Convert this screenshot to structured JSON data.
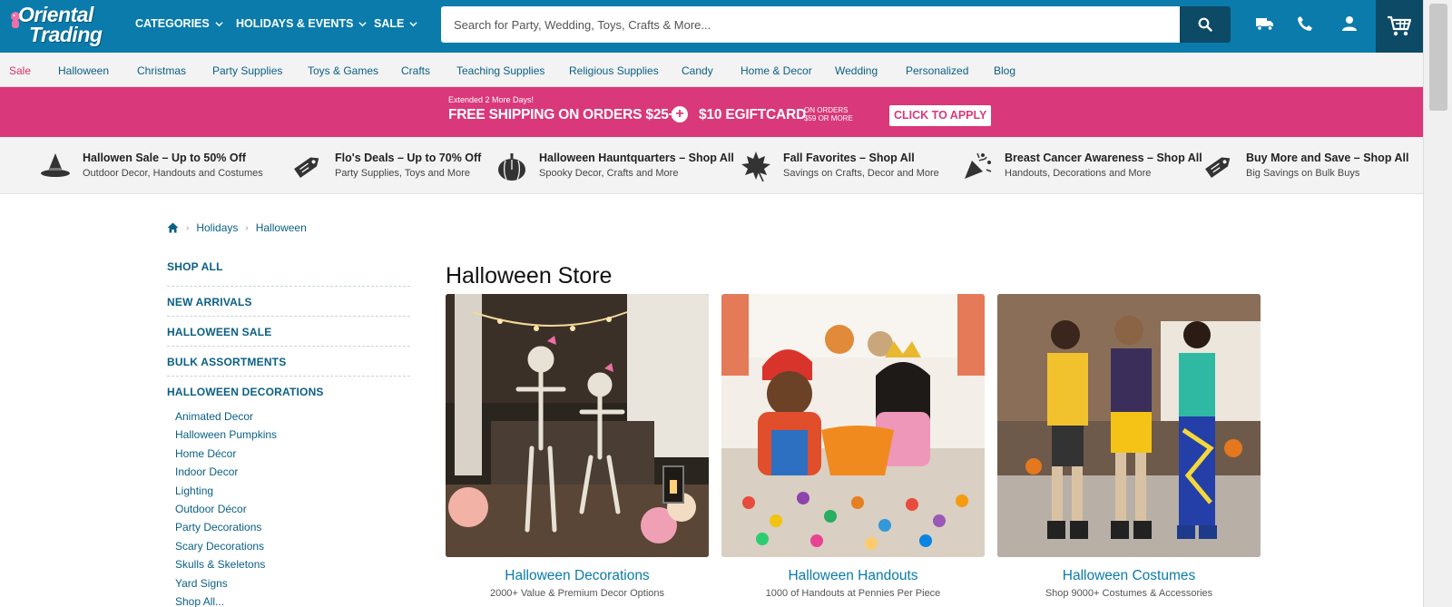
{
  "brand": {
    "line1": "Oriental",
    "line2": "Trading"
  },
  "header": {
    "nav": [
      {
        "label": "CATEGORIES"
      },
      {
        "label": "HOLIDAYS & EVENTS"
      },
      {
        "label": "SALE"
      }
    ],
    "search_placeholder": "Search for Party, Wedding, Toys, Crafts & More...",
    "icons": [
      "truck-icon",
      "phone-icon",
      "user-icon",
      "cart-icon"
    ]
  },
  "categories": [
    "Sale",
    "Halloween",
    "Christmas",
    "Party Supplies",
    "Toys & Games",
    "Crafts",
    "Teaching Supplies",
    "Religious Supplies",
    "Candy",
    "Home & Decor",
    "Wedding",
    "Personalized",
    "Blog"
  ],
  "promo": {
    "small": "Extended 2 More Days!",
    "offer1": "FREE SHIPPING ON ORDERS $25+",
    "offer2": "$10 EGIFTCARD",
    "on_orders_1": "ON ORDERS",
    "on_orders_2": "$59 OR MORE",
    "cta": "CLICK TO APPLY"
  },
  "deals": [
    {
      "title": "Hallowen Sale – Up to 50% Off",
      "sub": "Outdoor Decor, Handouts and Costumes",
      "icon": "witch-hat-icon"
    },
    {
      "title": "Flo's Deals – Up to 70% Off",
      "sub": "Party Supplies, Toys and More",
      "icon": "price-tag-icon"
    },
    {
      "title": "Halloween Hauntquarters – Shop All",
      "sub": "Spooky Decor, Crafts and More",
      "icon": "pumpkin-icon"
    },
    {
      "title": "Fall Favorites – Shop All",
      "sub": "Savings on Crafts, Decor and More",
      "icon": "leaf-icon"
    },
    {
      "title": "Breast Cancer Awareness – Shop All",
      "sub": "Handouts, Decorations and More",
      "icon": "confetti-icon"
    },
    {
      "title": "Buy More and Save – Shop All",
      "sub": "Big Savings on Bulk Buys",
      "icon": "price-tag-icon"
    }
  ],
  "breadcrumb": [
    "Holidays",
    "Halloween"
  ],
  "sidebar": {
    "categories": [
      "SHOP ALL",
      "NEW ARRIVALS",
      "HALLOWEEN SALE",
      "BULK ASSORTMENTS",
      "HALLOWEEN DECORATIONS"
    ],
    "subitems": [
      "Animated Decor",
      "Halloween Pumpkins",
      "Home Décor",
      "Indoor Decor",
      "Lighting",
      "Outdoor Décor",
      "Party Decorations",
      "Scary Decorations",
      "Skulls & Skeletons",
      "Yard Signs",
      "Shop All..."
    ]
  },
  "main": {
    "title": "Halloween Store",
    "cards": [
      {
        "title": "Halloween Decorations",
        "sub": "2000+ Value & Premium Decor Options"
      },
      {
        "title": "Halloween Handouts",
        "sub": "1000 of Handouts at Pennies Per Piece"
      },
      {
        "title": "Halloween Costumes",
        "sub": "Shop 9000+ Costumes & Accessories"
      }
    ]
  },
  "colors": {
    "header": "#0a7bab",
    "header_dark": "#0c4a66",
    "promo": "#d9387a",
    "link": "#0a5f84",
    "sale": "#d6336c"
  }
}
